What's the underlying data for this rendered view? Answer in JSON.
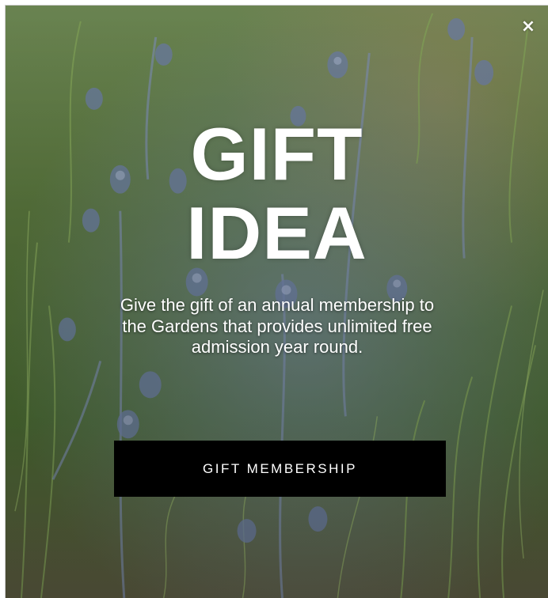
{
  "modal": {
    "close_glyph": "×",
    "headline_line1": "GIFT",
    "headline_line2": "IDEA",
    "body": "Give the gift of an annual membership to the Gardens that provides unlimited free admission year round.",
    "cta_label": "GIFT MEMBERSHIP"
  },
  "colors": {
    "text": "#ffffff",
    "button_bg": "#000000",
    "foliage": "#5a7a3a",
    "thistle_blue": "#7f8fb8"
  },
  "icons": {
    "close": "close-icon"
  }
}
